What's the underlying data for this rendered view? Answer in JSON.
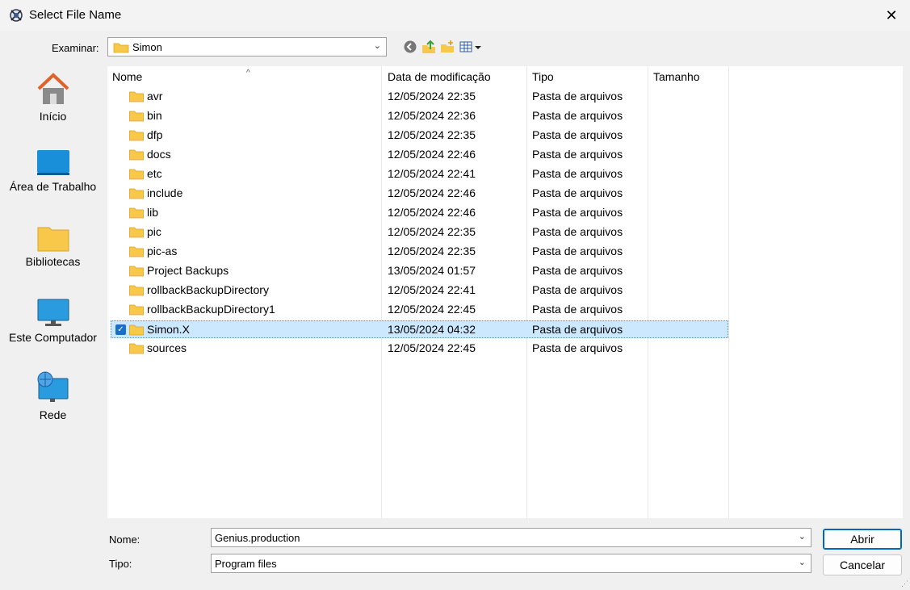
{
  "window": {
    "title": "Select File Name",
    "close_glyph": "✕"
  },
  "toolbar": {
    "look_in_label": "Examinar:",
    "look_in_value": "Simon",
    "icons": [
      "back-icon",
      "up-folder-icon",
      "new-folder-icon",
      "view-menu-icon"
    ]
  },
  "places": [
    {
      "label": "Início",
      "icon": "home-icon"
    },
    {
      "label": "Área de Trabalho",
      "icon": "desktop-icon"
    },
    {
      "label": "Bibliotecas",
      "icon": "libraries-icon"
    },
    {
      "label": "Este Computador",
      "icon": "computer-icon"
    },
    {
      "label": "Rede",
      "icon": "network-icon"
    }
  ],
  "columns": [
    "Nome",
    "Data de modificação",
    "Tipo",
    "Tamanho"
  ],
  "files": [
    {
      "name": "avr",
      "date": "12/05/2024 22:35",
      "type": "Pasta de arquivos"
    },
    {
      "name": "bin",
      "date": "12/05/2024 22:36",
      "type": "Pasta de arquivos"
    },
    {
      "name": "dfp",
      "date": "12/05/2024 22:35",
      "type": "Pasta de arquivos"
    },
    {
      "name": "docs",
      "date": "12/05/2024 22:46",
      "type": "Pasta de arquivos"
    },
    {
      "name": "etc",
      "date": "12/05/2024 22:41",
      "type": "Pasta de arquivos"
    },
    {
      "name": "include",
      "date": "12/05/2024 22:46",
      "type": "Pasta de arquivos"
    },
    {
      "name": "lib",
      "date": "12/05/2024 22:46",
      "type": "Pasta de arquivos"
    },
    {
      "name": "pic",
      "date": "12/05/2024 22:35",
      "type": "Pasta de arquivos"
    },
    {
      "name": "pic-as",
      "date": "12/05/2024 22:35",
      "type": "Pasta de arquivos"
    },
    {
      "name": "Project Backups",
      "date": "13/05/2024 01:57",
      "type": "Pasta de arquivos"
    },
    {
      "name": "rollbackBackupDirectory",
      "date": "12/05/2024 22:41",
      "type": "Pasta de arquivos"
    },
    {
      "name": "rollbackBackupDirectory1",
      "date": "12/05/2024 22:45",
      "type": "Pasta de arquivos"
    },
    {
      "name": "Simon.X",
      "date": "13/05/2024 04:32",
      "type": "Pasta de arquivos",
      "selected": true
    },
    {
      "name": "sources",
      "date": "12/05/2024 22:45",
      "type": "Pasta de arquivos"
    }
  ],
  "bottom": {
    "name_label": "Nome:",
    "name_value": "Genius.production",
    "type_label": "Tipo:",
    "type_value": "Program files",
    "open_button": "Abrir",
    "cancel_button": "Cancelar"
  },
  "colors": {
    "selection": "#cce8ff",
    "accent": "#0067c0",
    "folder": "#f8c84a"
  }
}
